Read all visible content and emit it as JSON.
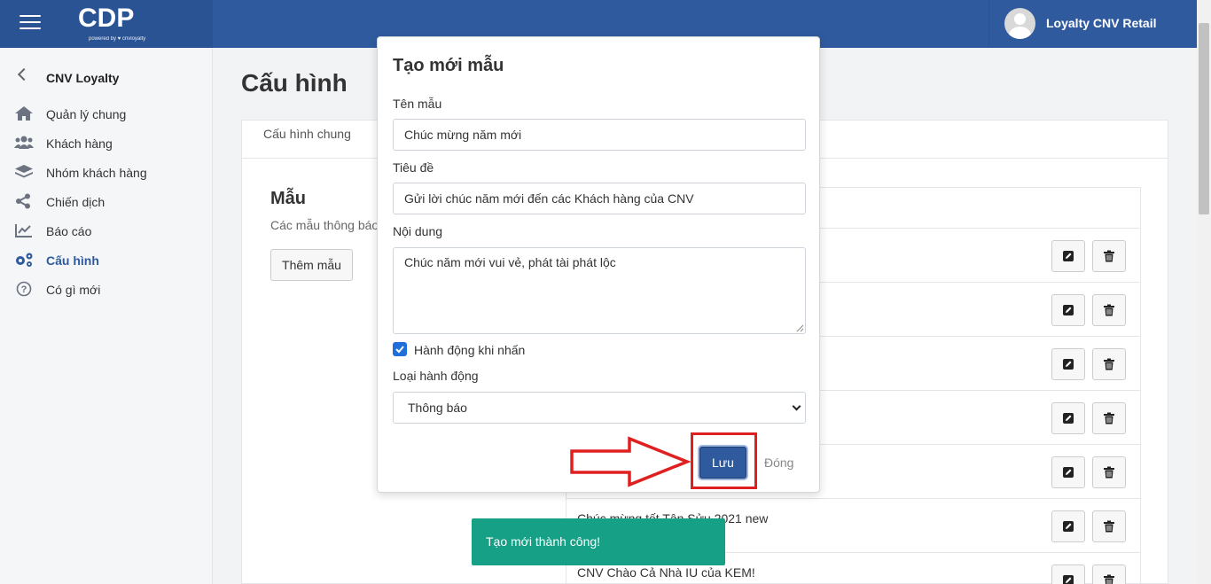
{
  "header": {
    "logo_text": "CDP",
    "logo_subtext": "powered by ♥ cnvloyalty",
    "user_name": "Loyalty CNV Retail"
  },
  "sidebar": {
    "back_label": "CNV Loyalty",
    "items": [
      {
        "label": "Quản lý chung",
        "icon": "home-icon"
      },
      {
        "label": "Khách hàng",
        "icon": "users-icon"
      },
      {
        "label": "Nhóm khách hàng",
        "icon": "layers-icon"
      },
      {
        "label": "Chiến dịch",
        "icon": "share-icon"
      },
      {
        "label": "Báo cáo",
        "icon": "chart-line-icon"
      },
      {
        "label": "Cấu hình",
        "icon": "gears-icon",
        "active": true
      },
      {
        "label": "Có gì mới",
        "icon": "question-icon"
      }
    ]
  },
  "main": {
    "page_title": "Cấu hình",
    "tab_general": "Cấu hình chung",
    "section_title": "Mẫu",
    "section_desc": "Các mẫu thông báo",
    "add_button": "Thêm mẫu",
    "rows": [
      {
        "name": ""
      },
      {
        "name": ""
      },
      {
        "name": ""
      },
      {
        "name": ""
      },
      {
        "name": ""
      },
      {
        "name": "Chúc mừng tết Tân Sửu 2021 new"
      },
      {
        "name": "CNV Chào Cả Nhà IU của KEM!"
      }
    ]
  },
  "modal": {
    "title": "Tạo mới mẫu",
    "name_label": "Tên mẫu",
    "name_value": "Chúc mừng năm mới",
    "subject_label": "Tiêu đề",
    "subject_value": "Gửi lời chúc năm mới đến các Khách hàng của CNV",
    "content_label": "Nội dung",
    "content_value": "Chúc năm mới vui vẻ, phát tài phát lộc",
    "action_checkbox_label": "Hành động khi nhấn",
    "action_checked": true,
    "action_type_label": "Loại hành động",
    "action_type_value": "Thông báo",
    "save_button": "Lưu",
    "close_button": "Đóng"
  },
  "toast": {
    "message": "Tạo mới thành công!"
  },
  "colors": {
    "header": "#2f5b9e",
    "accent": "#2f5b9e",
    "toast": "#16a085",
    "annotation": "#e02020"
  }
}
